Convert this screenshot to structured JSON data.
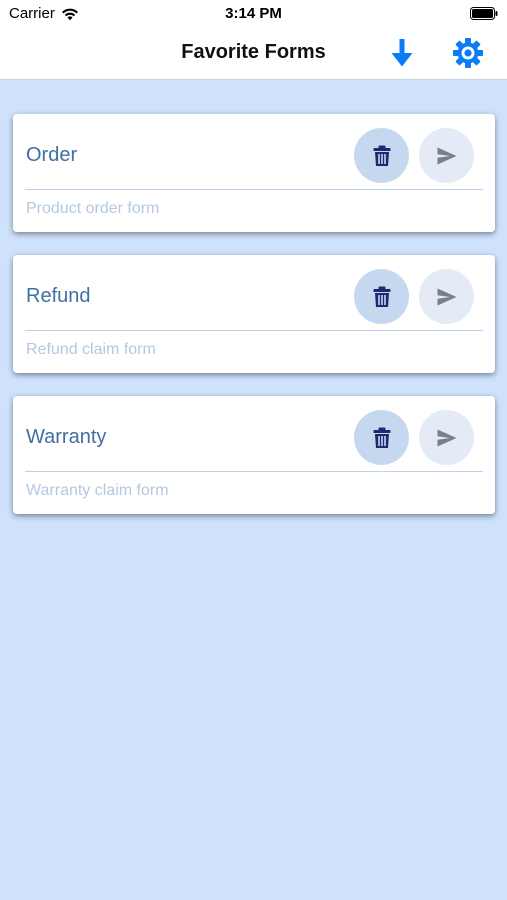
{
  "status_bar": {
    "carrier": "Carrier",
    "time": "3:14 PM"
  },
  "nav": {
    "title": "Favorite Forms",
    "download_icon": "download-arrow-icon",
    "settings_icon": "gear-icon",
    "accent_color": "#0a7cf5"
  },
  "forms": [
    {
      "title": "Order",
      "description": "Product order form"
    },
    {
      "title": "Refund",
      "description": "Refund claim form"
    },
    {
      "title": "Warranty",
      "description": "Warranty claim form"
    }
  ],
  "colors": {
    "background": "#cfe2fb",
    "title_text": "#3f6fa3",
    "description_text": "#b4c8e0",
    "delete_button_bg": "#c6d8ef",
    "delete_icon": "#1b2a6e",
    "send_button_bg": "#e4ebf6",
    "send_icon": "#7a8087"
  },
  "card_icons": {
    "delete": "trash-icon",
    "send": "send-icon"
  }
}
